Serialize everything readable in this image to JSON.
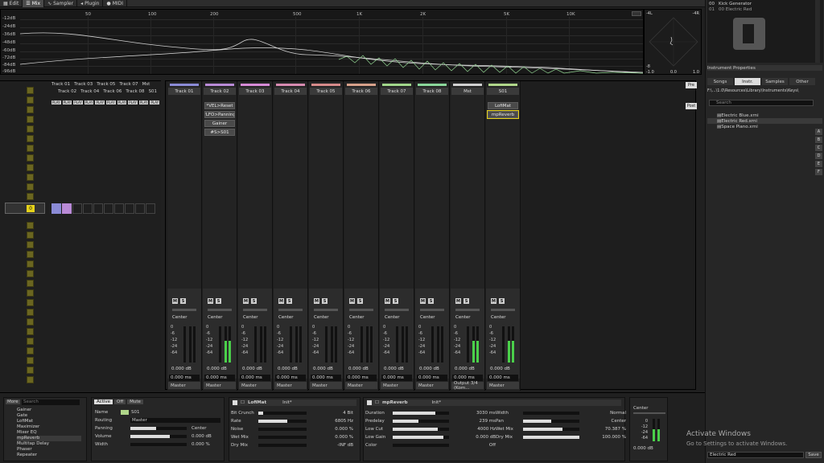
{
  "topbar": {
    "tabs": [
      {
        "label": "Edit"
      },
      {
        "label": "Mix"
      },
      {
        "label": "Sampler"
      },
      {
        "label": "Plugin"
      },
      {
        "label": "MIDI"
      }
    ]
  },
  "spectrum": {
    "db_labels": [
      "-12dB",
      "-24dB",
      "-36dB",
      "-48dB",
      "-60dB",
      "-72dB",
      "-84dB",
      "-96dB"
    ],
    "freq_labels": [
      "50",
      "100",
      "200",
      "500",
      "1K",
      "2K",
      "5K",
      "10K"
    ],
    "scope_labels": {
      "tl": "-4L",
      "tr": "-4R",
      "bl": "-8",
      "b1": "-1.0",
      "b2": "0.0",
      "b3": "1.0"
    }
  },
  "browser": {
    "top_items": [
      {
        "num": "00",
        "name": "Kick Generator"
      },
      {
        "num": "01",
        "name": "00 Electric Red"
      }
    ],
    "props_title": "Instrument Properties",
    "tabs": [
      {
        "label": "Songs"
      },
      {
        "label": "Instr."
      },
      {
        "label": "Samples"
      },
      {
        "label": "Other"
      }
    ],
    "path": "F:\\...\\1.0\\Resources\\Library\\Instruments\\Keys\\",
    "search_placeholder": "Search",
    "files": [
      {
        "name": "Electric Blue.xrni"
      },
      {
        "name": "Electric Red.xrni"
      },
      {
        "name": "Space Piano.xrni"
      }
    ],
    "side_letters": [
      "A",
      "B",
      "C",
      "D",
      "E",
      "F"
    ],
    "bottom_field": "Electric Red",
    "save_label": "Save"
  },
  "pattern": {
    "track_header_top": [
      "Track 01",
      "Track 03",
      "Track 05",
      "Track 07",
      "Mst"
    ],
    "track_header_bottom": [
      "Track 02",
      "Track 04",
      "Track 06",
      "Track 08",
      "S01"
    ],
    "play_label": "PLAY",
    "pos_value": "0"
  },
  "mixer": {
    "side_buttons": [
      "Pre",
      "Post"
    ],
    "scale": [
      "0",
      "-6",
      "-12",
      "-24",
      "-64"
    ],
    "center_label": "Center",
    "strips": [
      {
        "name": "Track 01",
        "color": "#8b8bd6",
        "slots": [],
        "volume": "0.000 dB",
        "routing": "Master"
      },
      {
        "name": "Track 02",
        "color": "#b98ad6",
        "slots": [
          "*VEL>Reset",
          "*LFO>Panning",
          "Gainer",
          "#S>S01"
        ],
        "volume": "0.000 dB",
        "routing": "Master"
      },
      {
        "name": "Track 03",
        "color": "#d68ad6",
        "slots": [],
        "volume": "0.000 dB",
        "routing": "Master"
      },
      {
        "name": "Track 04",
        "color": "#d68ab0",
        "slots": [],
        "volume": "0.000 dB",
        "routing": "Master"
      },
      {
        "name": "Track 05",
        "color": "#d68a8a",
        "slots": [],
        "volume": "0.000 dB",
        "routing": "Master"
      },
      {
        "name": "Track 06",
        "color": "#d6a08a",
        "slots": [],
        "volume": "0.000 dB",
        "routing": "Master"
      },
      {
        "name": "Track 07",
        "color": "#a0d68a",
        "slots": [],
        "volume": "0.000 dB",
        "routing": "Master"
      },
      {
        "name": "Track 08",
        "color": "#8ad69a",
        "slots": [],
        "volume": "0.000 dB",
        "routing": "Master"
      },
      {
        "name": "Mst",
        "color": "#d0d0d0",
        "slots": [],
        "volume": "0.000 dB",
        "routing": "Output 3/4 (Kom..."
      },
      {
        "name": "S01",
        "color": "#b0d68a",
        "slots": [
          "LofiMat",
          "mpReverb"
        ],
        "volume": "0.000 dB",
        "routing": "Master"
      }
    ],
    "ms": {
      "m": "M",
      "s": "S"
    },
    "ms_suffix": "ms"
  },
  "devices": {
    "more_label": "More",
    "search_placeholder": "Search",
    "list": [
      "Gainer",
      "Gate",
      "LofiMat",
      "Maximizer",
      "Mixer EQ",
      "mpReverb",
      "Multitap Delay",
      "Phaser",
      "Repeater"
    ],
    "track_panel": {
      "tabs": [
        "Active",
        "Off",
        "Mute"
      ],
      "rows": [
        {
          "label": "Name",
          "value": "S01"
        },
        {
          "label": "Routing",
          "value": "Master"
        },
        {
          "label": "Panning",
          "value": "Center"
        },
        {
          "label": "Volume",
          "value": "0.000 dB"
        },
        {
          "label": "Width",
          "value": "0.000 %"
        }
      ]
    },
    "lofimat": {
      "title": "LofiMat",
      "preset": "Init*",
      "rows": [
        {
          "label": "Bit Crunch",
          "value": "4 Bit",
          "fill": 0.1
        },
        {
          "label": "Rate",
          "value": "6805 Hz",
          "fill": 0.6
        },
        {
          "label": "Noise",
          "value": "0.000 %",
          "fill": 0.0
        },
        {
          "label": "Wet Mix",
          "value": "0.000 %",
          "fill": 0.0
        },
        {
          "label": "Dry Mix",
          "value": "-INF dB",
          "fill": 0.0
        }
      ]
    },
    "mpreverb": {
      "title": "mpReverb",
      "preset": "Init*",
      "left": [
        {
          "label": "Duration",
          "value": "3030 ms",
          "fill": 0.75
        },
        {
          "label": "Predelay",
          "value": "239 ms",
          "fill": 0.45
        },
        {
          "label": "Low Cut",
          "value": "4000 Hz",
          "fill": 0.8
        },
        {
          "label": "Low Gain",
          "value": "0.000 dB",
          "fill": 0.9
        },
        {
          "label": "Color",
          "value": "Off",
          "fill": 0.0
        }
      ],
      "right": [
        {
          "label": "Width",
          "value": "Normal",
          "fill": 0.0
        },
        {
          "label": "Pan",
          "value": "Center",
          "fill": 0.5
        },
        {
          "label": "Wet Mix",
          "value": "70.387 %",
          "fill": 0.7
        },
        {
          "label": "Dry Mix",
          "value": "100.000 %",
          "fill": 1.0
        }
      ]
    },
    "meter_panel": {
      "label": "Center",
      "scale": [
        "0",
        "-12",
        "-24",
        "-64"
      ],
      "value": "0.000 dB"
    }
  },
  "watermark": {
    "title": "Activate Windows",
    "subtitle": "Go to Settings to activate Windows."
  }
}
